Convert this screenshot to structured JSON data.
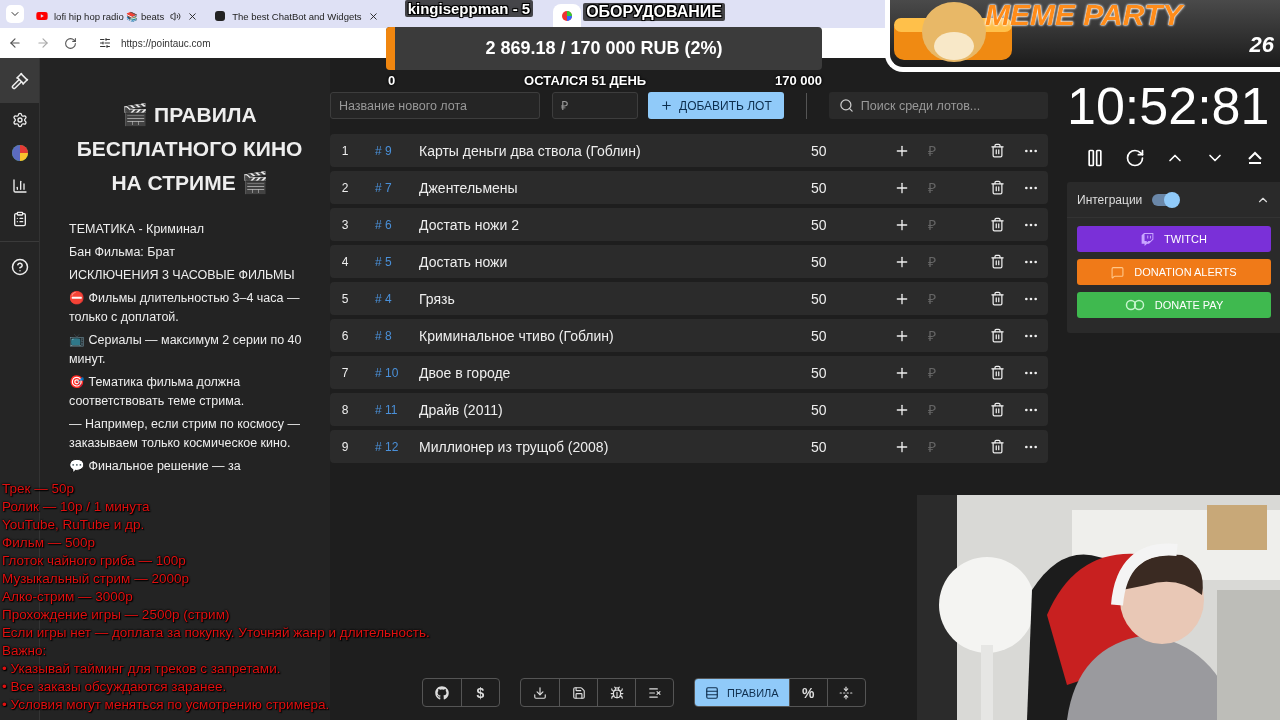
{
  "browser": {
    "tabs": [
      {
        "kind": "video",
        "title": "lofi hip hop radio 📚 beats",
        "audio": true,
        "selected": false
      },
      {
        "kind": "bot",
        "title": "The best ChatBot and Widgets",
        "audio": false,
        "selected": false
      },
      {
        "kind": "wheel",
        "audio": false,
        "selected": true
      }
    ],
    "address": "https://pointauc.com"
  },
  "stream_overlay": {
    "channel": "kingiseppman - 5",
    "scene": "ОБОРУДОВАНИЕ"
  },
  "goal": {
    "text": "2 869.18 / 170 000 RUB (2%)",
    "level": 0.02,
    "min": "0",
    "caption": "ОСТАЛСЯ 51 ДЕНЬ",
    "max": "170 000"
  },
  "banner": {
    "title": "MEME PARTY",
    "count": "26"
  },
  "sidebar": {
    "items": [
      {
        "kind": "gavel",
        "selected": true
      },
      {
        "kind": "settings",
        "selected": false
      },
      {
        "kind": "pie",
        "selected": false
      },
      {
        "kind": "bars",
        "selected": false
      },
      {
        "kind": "clipboard",
        "selected": false
      }
    ],
    "footer": [
      {
        "kind": "help",
        "selected": false
      }
    ]
  },
  "rules": {
    "title": "🎬 ПРАВИЛА БЕСПЛАТНОГО КИНО НА СТРИМЕ 🎬",
    "lines": [
      "ТЕМАТИКА - Криминал",
      "Бан Фильма: Брат",
      "ИСКЛЮЧЕНИЯ  3 ЧАСОВЫЕ ФИЛЬМЫ",
      "⛔ Фильмы длительностью 3–4 часа — только с доплатой.",
      "📺 Сериалы — максимум 2 серии по 40 минут.",
      "🎯 Тематика фильма должна соответствовать теме стрима.",
      "— Например, если стрим по космосу — заказываем только космическое кино.",
      "💬 Финальное решение — за"
    ]
  },
  "lot_form": {
    "name_placeholder": "Название нового лота",
    "amount_placeholder": "₽",
    "add_button": "ДОБАВИТЬ ЛОТ",
    "search_placeholder": "Поиск среди лотов..."
  },
  "lots": [
    {
      "index": "1",
      "id": "# 9",
      "name": "Карты деньги два ствола (Гоблин)",
      "amount": "50",
      "currency": "₽"
    },
    {
      "index": "2",
      "id": "# 7",
      "name": "Джентельмены",
      "amount": "50",
      "currency": "₽"
    },
    {
      "index": "3",
      "id": "# 6",
      "name": "Достать ножи 2",
      "amount": "50",
      "currency": "₽"
    },
    {
      "index": "4",
      "id": "# 5",
      "name": "Достать ножи",
      "amount": "50",
      "currency": "₽"
    },
    {
      "index": "5",
      "id": "# 4",
      "name": "Грязь",
      "amount": "50",
      "currency": "₽"
    },
    {
      "index": "6",
      "id": "# 8",
      "name": "Криминальное чтиво  (Гоблин)",
      "amount": "50",
      "currency": "₽"
    },
    {
      "index": "7",
      "id": "# 10",
      "name": "Двое в городе",
      "amount": "50",
      "currency": "₽"
    },
    {
      "index": "8",
      "id": "# 11",
      "name": "Драйв (2011)",
      "amount": "50",
      "currency": "₽"
    },
    {
      "index": "9",
      "id": "# 12",
      "name": "Миллионер из трущоб (2008)",
      "amount": "50",
      "currency": "₽"
    }
  ],
  "toolbar": {
    "groups": [
      [
        {
          "kind": "github",
          "selected": false
        },
        {
          "kind": "text",
          "label": "$",
          "selected": false
        }
      ],
      [
        {
          "kind": "download",
          "selected": false
        },
        {
          "kind": "save",
          "selected": false
        },
        {
          "kind": "bug",
          "selected": false
        },
        {
          "kind": "clear",
          "selected": false
        }
      ],
      [
        {
          "kind": "rules",
          "label": "ПРАВИЛА",
          "selected": true
        },
        {
          "kind": "text",
          "label": "%",
          "selected": false
        },
        {
          "kind": "fold",
          "selected": false
        }
      ]
    ]
  },
  "timer": "10:52:81",
  "integrations": {
    "label": "Интеграции",
    "on": true,
    "expanded": true,
    "services": [
      {
        "kind": "twitch",
        "label": "TWITCH",
        "color": "#7a30d8"
      },
      {
        "kind": "alerts",
        "label": "DONATION ALERTS",
        "color": "#f07a18"
      },
      {
        "kind": "pay",
        "label": "DONATE PAY",
        "color": "#3fb94f"
      }
    ]
  },
  "price_overlay": [
    "Трек — 50р",
    "Ролик — 10р / 1 минута",
    "YouTube, RuTube и др.",
    "Фильм — 500р",
    "Глоток чайного гриба — 100р",
    "Музыкальный стрим — 2000р",
    "Алко-стрим — 3000р",
    "Прохождение игры — 2500р (стрим)",
    "Если игры нет — доплата за покупку. Уточняй жанр и длительность.",
    "Важно:",
    "• Указывай тайминг для треков с запретами.",
    "• Все заказы обсуждаются заранее.",
    "• Условия могут меняться по усмотрению стримера."
  ]
}
